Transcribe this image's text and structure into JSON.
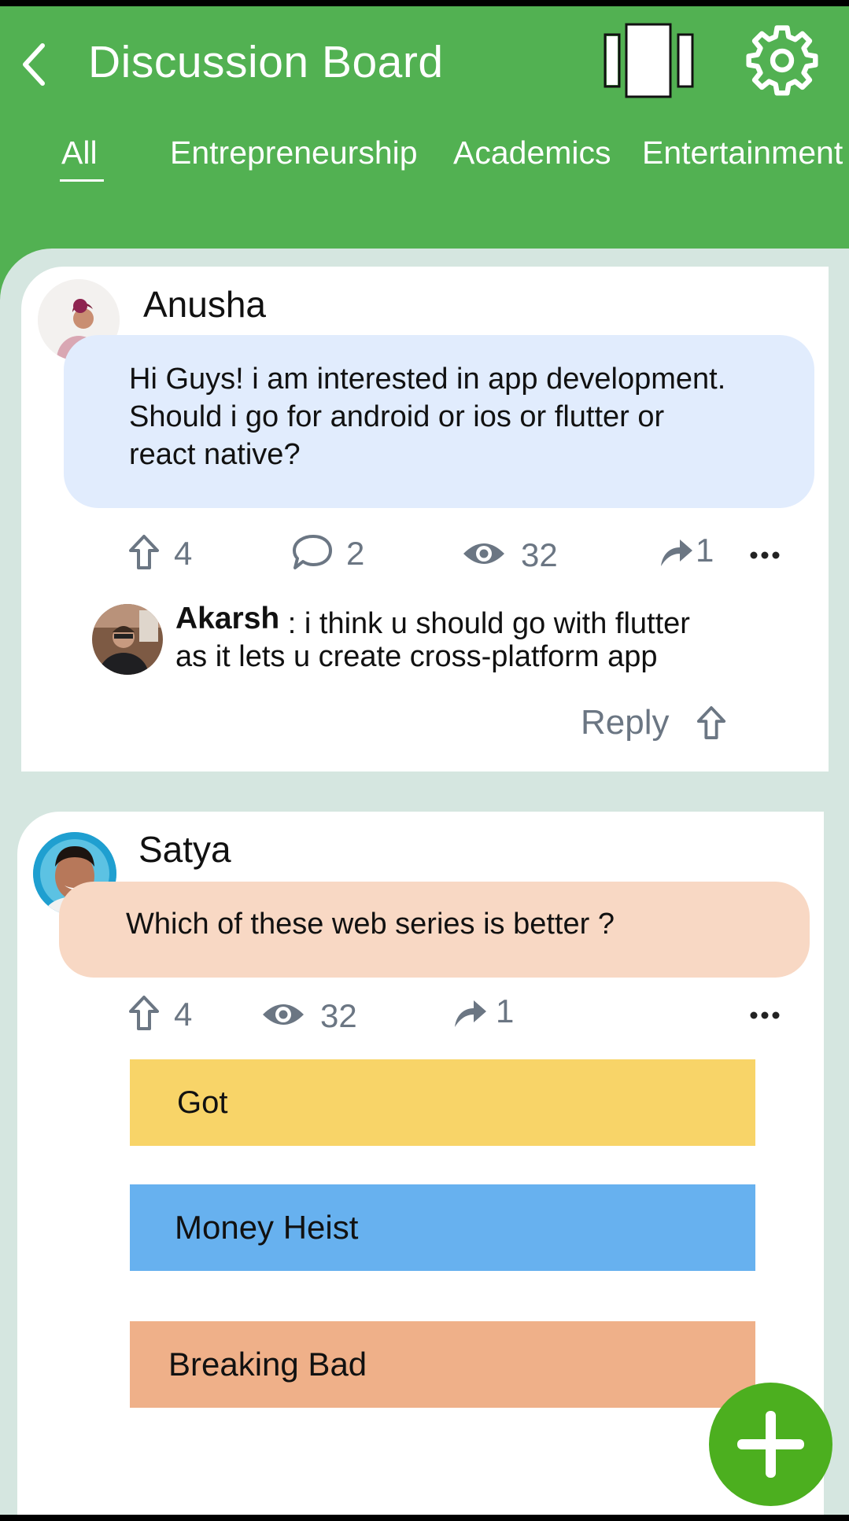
{
  "header": {
    "title": "Discussion Board"
  },
  "tabs": [
    {
      "label": "All",
      "active": true
    },
    {
      "label": "Entrepreneurship",
      "active": false
    },
    {
      "label": "Academics",
      "active": false
    },
    {
      "label": "Entertainment",
      "active": false
    }
  ],
  "posts": [
    {
      "author": "Anusha",
      "text_lines": [
        "Hi Guys! i am interested in app development.",
        "Should i go for android or ios or flutter or",
        "react native?"
      ],
      "bubble_color": "#e1ecfd",
      "upvotes": "4",
      "comments": "2",
      "views": "32",
      "shares": "1",
      "reply": {
        "author": "Akarsh",
        "text_line1": ": i think u should go with flutter",
        "text_line2": "as it lets u create cross-platform app",
        "reply_label": "Reply"
      }
    },
    {
      "author": "Satya",
      "text": "Which of these web series is better ?",
      "bubble_color": "#f8d8c4",
      "upvotes": "4",
      "views": "32",
      "shares": "1",
      "poll_options": [
        {
          "label": "Got",
          "color": "#f8d468"
        },
        {
          "label": "Money Heist",
          "color": "#67b1ef"
        },
        {
          "label": "Breaking Bad",
          "color": "#efb089"
        }
      ]
    }
  ],
  "colors": {
    "header_bg": "#52b152",
    "content_bg": "#d5e6e0",
    "stat_gray": "#6b7683",
    "fab_green": "#4caf1f"
  },
  "icons": [
    "back-arrow-icon",
    "layout-cards-icon",
    "gear-icon",
    "upvote-arrow-icon",
    "comment-bubble-icon",
    "eye-icon",
    "share-arrow-icon",
    "more-dots-icon",
    "plus-icon"
  ]
}
